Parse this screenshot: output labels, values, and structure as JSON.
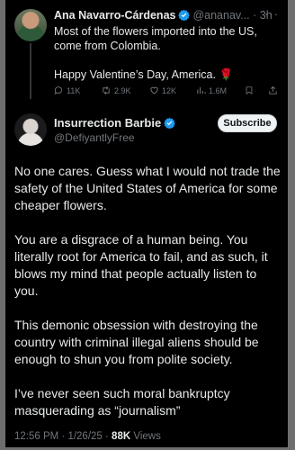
{
  "parent_tweet": {
    "author_name": "Ana Navarro-Cárdenas",
    "handle_time": "@ananav... · 3h",
    "more": "···",
    "paragraph_1": "Most of the flowers imported into the US, come from Colombia.",
    "paragraph_2": "Happy Valentine’s Day, America.",
    "emoji": "🌹",
    "replies": "11K",
    "reposts": "2.9K",
    "likes": "12K",
    "views": "1.6M"
  },
  "reply_tweet": {
    "author_name": "Insurrection Barbie",
    "handle": "@DefiyantlyFree",
    "subscribe_label": "Subscribe",
    "paragraphs": [
      "No one cares. Guess what I would not trade the safety of the United States of America for some cheaper flowers.",
      "You are a disgrace of a human being. You literally root for America to fail, and as such, it blows my mind that people actually listen to you.",
      "This demonic obsession with destroying the country with criminal illegal aliens should be enough to shun you from polite society.",
      "I’ve never seen such moral bankruptcy masquerading as “journalism”"
    ],
    "timestamp": "12:56 PM · 1/26/25 · ",
    "views_count": "88K",
    "views_label": " Views"
  },
  "colors": {
    "background": "#000000",
    "text": "#e7e9ea",
    "muted": "#71767b",
    "verified": "#1d9bf0"
  }
}
